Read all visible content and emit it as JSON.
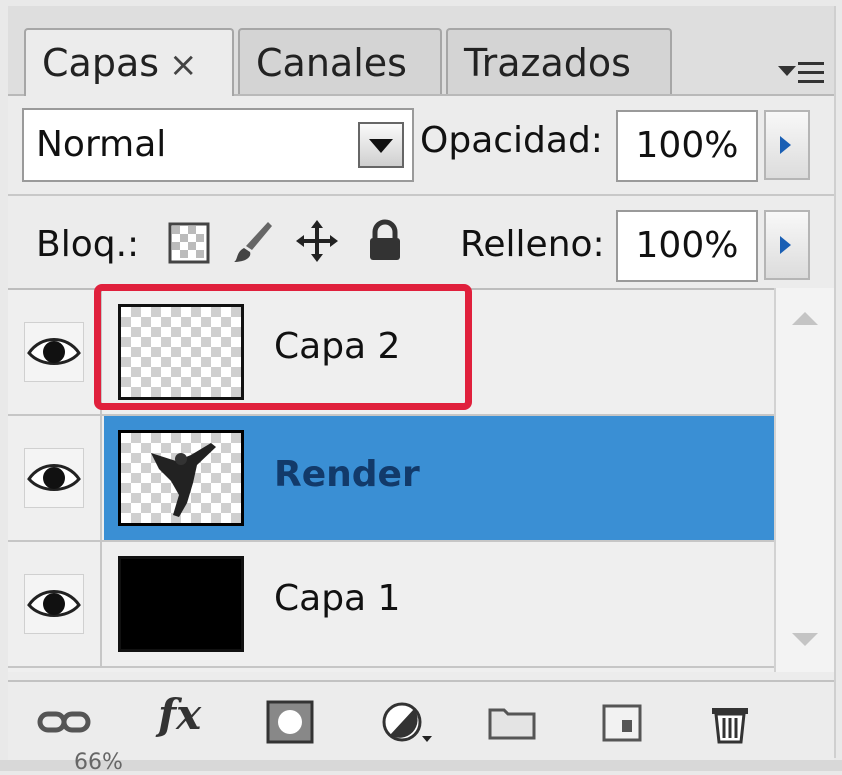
{
  "tabs": [
    {
      "label": "Capas",
      "close": "×",
      "active": true
    },
    {
      "label": "Canales",
      "active": false
    },
    {
      "label": "Trazados",
      "active": false
    }
  ],
  "blend_mode": {
    "value": "Normal"
  },
  "opacity": {
    "label": "Opacidad:",
    "value": "100%"
  },
  "lock": {
    "label": "Bloq.:"
  },
  "fill": {
    "label": "Relleno:",
    "value": "100%"
  },
  "layers": [
    {
      "name": "Capa 2",
      "selected": false,
      "visible": true,
      "highlighted": true
    },
    {
      "name": "Render",
      "selected": true,
      "visible": true
    },
    {
      "name": "Capa 1",
      "selected": false,
      "visible": true
    }
  ],
  "colors": {
    "selection": "#3a8fd4",
    "highlight": "#e0203c"
  },
  "toolbar_icons": [
    "link-layers-icon",
    "fx-icon",
    "mask-icon",
    "adjustment-icon",
    "folder-icon",
    "new-layer-icon",
    "trash-icon"
  ],
  "toolbar": {
    "fx": "fx"
  },
  "footer": {
    "zoom": "66%"
  }
}
